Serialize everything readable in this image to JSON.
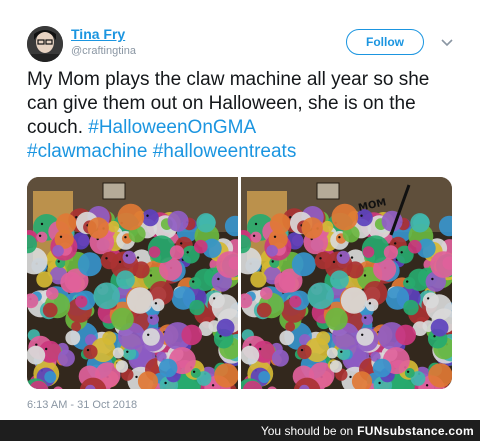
{
  "tweet": {
    "display_name": "Tina Fry",
    "handle": "@craftingtina",
    "follow_label": "Follow",
    "text_parts": [
      "My Mom plays the claw machine all year so she can give them out on Halloween, she is on the couch. ",
      "#HalloweenOnGMA",
      "#clawmachine",
      " ",
      "#halloweentreats"
    ],
    "timestamp": "6:13 AM - 31 Oct 2018",
    "photo_annotation": "MOM",
    "accent_color": "#1b95e0"
  },
  "footer": {
    "text": "You should be on",
    "brand": "FUNsubstance.com"
  }
}
